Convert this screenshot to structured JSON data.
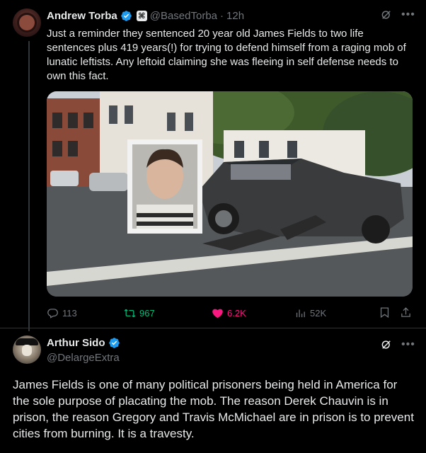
{
  "tweet1": {
    "author_name": "Andrew Torba",
    "handle": "@BasedTorba",
    "separator": "·",
    "time": "12h",
    "affiliate_badge": "⌘",
    "text": "Just a reminder they sentenced 20 year old James Fields to two life sentences plus 419 years(!) for trying to defend himself from a raging mob of lunatic leftists. Any leftoid claiming she was fleeing in self defense needs to own this fact.",
    "stats": {
      "replies": "113",
      "reposts": "967",
      "likes": "6.2K",
      "views": "52K"
    },
    "colors": {
      "repost": "#00ba7c",
      "like": "#f91880",
      "muted": "#71767b"
    }
  },
  "tweet2": {
    "author_name": "Arthur Sido",
    "handle": "@DelargeExtra",
    "text": "James Fields is one of many political prisoners being held in America for the sole purpose of placating the mob. The reason Derek Chauvin is in prison, the reason Gregory and Travis McMichael are in prison is to prevent cities from burning. It is a travesty."
  },
  "icons": [
    "verified-badge-icon",
    "grok-icon",
    "more-icon",
    "reply-icon",
    "repost-icon",
    "like-icon",
    "views-icon",
    "bookmark-icon",
    "share-icon"
  ],
  "accent": "#1d9bf0"
}
